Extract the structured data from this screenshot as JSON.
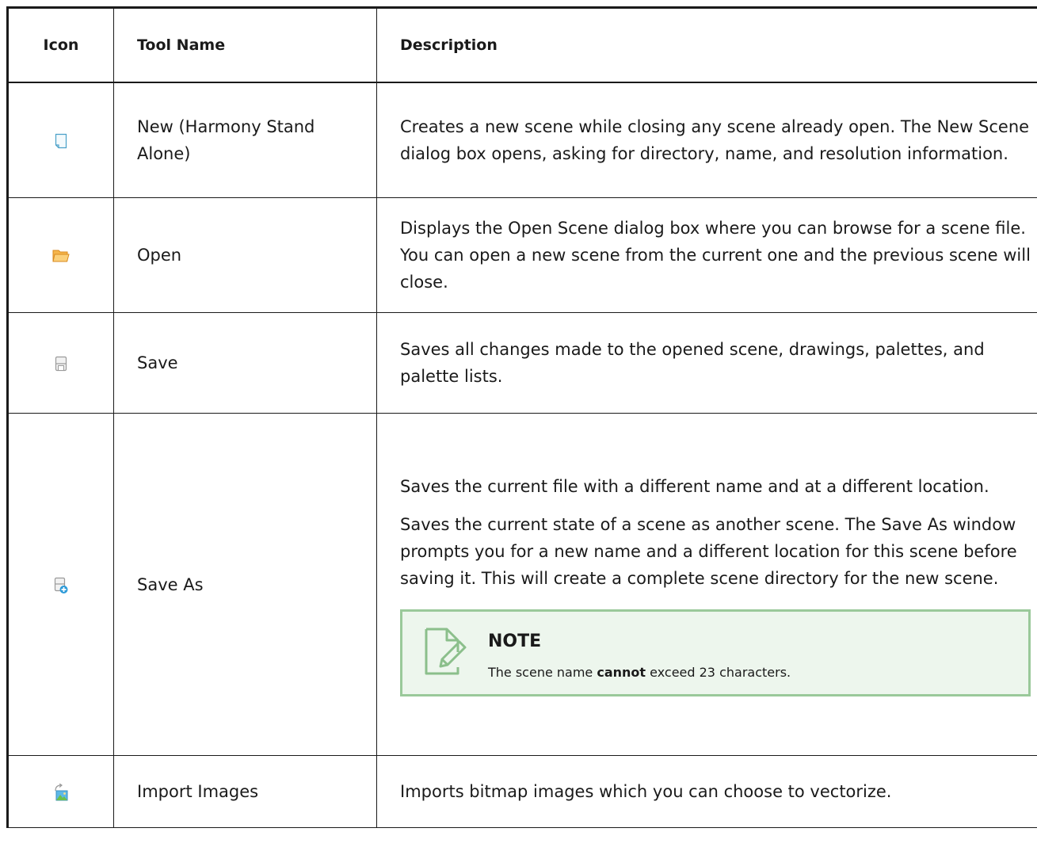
{
  "table": {
    "headers": {
      "icon": "Icon",
      "tool_name": "Tool Name",
      "description": "Description"
    },
    "rows": [
      {
        "icon": "new-scene-icon",
        "name": "New (Harmony Stand Alone)",
        "description": [
          "Creates a new scene while closing any scene already open. The New Scene dialog box opens, asking for directory, name, and resolution information."
        ]
      },
      {
        "icon": "open-folder-icon",
        "name": "Open",
        "description": [
          "Displays the Open Scene dialog box where you can browse for a scene file. You can open a new scene from the current one and the previous scene will close."
        ]
      },
      {
        "icon": "save-icon",
        "name": "Save",
        "description": [
          "Saves all changes made to the opened scene, drawings, palettes, and palette lists."
        ]
      },
      {
        "icon": "save-as-icon",
        "name": "Save As",
        "description": [
          "Saves the current file with a different name and at a different location.",
          "Saves the current state of a scene as another scene. The Save As window prompts you for a new name and a different location for this scene before saving it. This will create a complete scene directory for the new scene."
        ],
        "note": {
          "icon": "pencil-note-icon",
          "title": "NOTE",
          "text_before": "The scene name ",
          "text_bold": "cannot",
          "text_after": " exceed 23 characters."
        }
      },
      {
        "icon": "import-images-icon",
        "name": "Import Images",
        "description": [
          "Imports bitmap images which you can choose to vectorize."
        ]
      }
    ]
  },
  "colors": {
    "note_border": "#9ac99a",
    "note_background": "#edf6ed",
    "note_icon": "#8bbf8b",
    "folder_icon": "#f0a840",
    "new_icon": "#4aa0c8"
  }
}
